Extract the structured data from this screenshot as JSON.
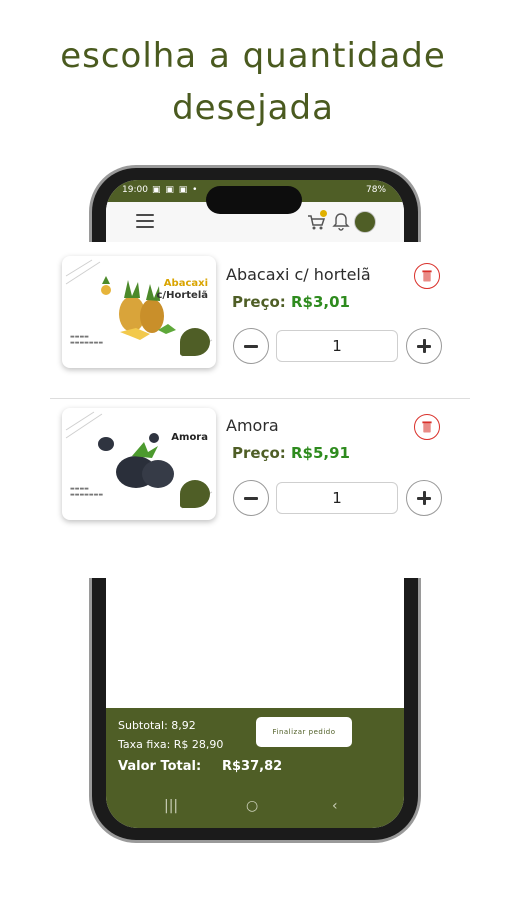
{
  "headline": {
    "line1": "escolha a quantidade",
    "line2": "desejada"
  },
  "statusbar": {
    "time": "19:00",
    "icons_left": "▣ ▣ ▣ •",
    "signal": "   78%"
  },
  "items": [
    {
      "name": "Abacaxi c/ hortelã",
      "price_label": "Preço:",
      "price_value": "R$3,01",
      "quantity": "1",
      "image_brand_line1": "Abacaxi",
      "image_brand_line2": "c/Hortelã"
    },
    {
      "name": "Amora",
      "price_label": "Preço:",
      "price_value": "R$5,91",
      "quantity": "1",
      "image_brand_line1": "Amora",
      "image_brand_line2": ""
    }
  ],
  "footer": {
    "subtotal": "Subtotal: 8,92",
    "tax": "Taxa fixa: R$ 28,90",
    "total_label": "Valor Total:",
    "total_value": "R$37,82",
    "finalize_label": "Finalizar pedido"
  },
  "colors": {
    "brand": "#4f5e26",
    "price": "#2e8b1e",
    "delete": "#d9302a"
  },
  "icons": [
    "menu-icon",
    "cart-icon",
    "bell-icon",
    "avatar",
    "trash-icon",
    "minus-icon",
    "plus-icon",
    "recents-icon",
    "home-icon",
    "back-icon"
  ]
}
